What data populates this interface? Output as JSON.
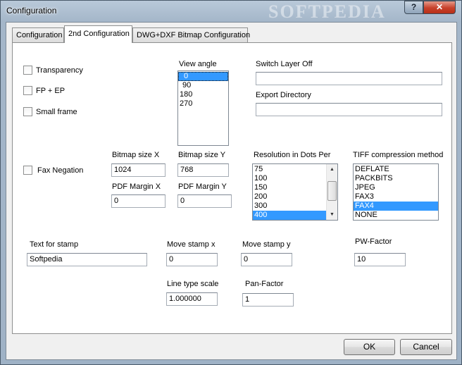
{
  "window": {
    "title": "Configuration",
    "watermark": "SOFTPEDIA",
    "help_label": "?",
    "close_label": "✕"
  },
  "tabs": [
    {
      "label": "Configuration"
    },
    {
      "label": "2nd Configuration"
    },
    {
      "label": "DWG+DXF Bitmap Configuration"
    }
  ],
  "active_tab": "2nd Configuration",
  "options": {
    "transparency": {
      "label": "Transparency",
      "checked": false
    },
    "fp_ep": {
      "label": "FP + EP",
      "checked": false
    },
    "small_frame": {
      "label": "Small frame",
      "checked": false
    },
    "fax_negation": {
      "label": "Fax Negation",
      "checked": false
    }
  },
  "view_angle": {
    "label": "View angle",
    "items": [
      "0",
      "90",
      "180",
      "270"
    ],
    "selected": "0"
  },
  "switch_layer_off": {
    "label": "Switch Layer Off",
    "value": ""
  },
  "export_directory": {
    "label": "Export Directory",
    "value": ""
  },
  "bitmap_size_x": {
    "label": "Bitmap size X",
    "value": "1024"
  },
  "bitmap_size_y": {
    "label": "Bitmap size Y",
    "value": "768"
  },
  "pdf_margin_x": {
    "label": "PDF Margin X",
    "value": "0"
  },
  "pdf_margin_y": {
    "label": "PDF Margin Y",
    "value": "0"
  },
  "resolution": {
    "label": "Resolution in Dots Per",
    "items": [
      "75",
      "100",
      "150",
      "200",
      "300",
      "400"
    ],
    "selected": "400"
  },
  "tiff_compression": {
    "label": "TIFF compression method",
    "items": [
      "DEFLATE",
      "PACKBITS",
      "JPEG",
      "FAX3",
      "FAX4",
      "NONE"
    ],
    "selected": "FAX4"
  },
  "text_for_stamp": {
    "label": "Text for stamp",
    "value": "Softpedia"
  },
  "move_stamp_x": {
    "label": "Move stamp x",
    "value": "0"
  },
  "move_stamp_y": {
    "label": "Move stamp y",
    "value": "0"
  },
  "pw_factor": {
    "label": "PW-Factor",
    "value": "10"
  },
  "line_type_scale": {
    "label": "Line type scale",
    "value": "1.000000"
  },
  "pan_factor": {
    "label": "Pan-Factor",
    "value": "1"
  },
  "buttons": {
    "ok": "OK",
    "cancel": "Cancel"
  },
  "colors": {
    "selection": "#3399ff",
    "close_button": "#c7402a"
  }
}
